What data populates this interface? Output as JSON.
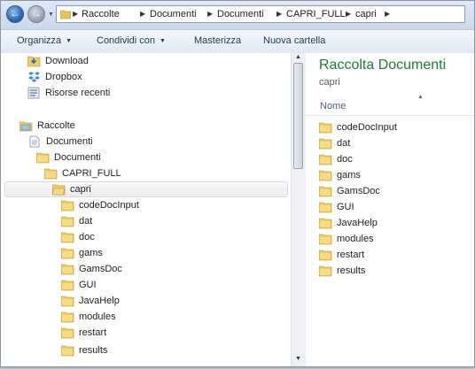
{
  "window": {
    "accent": "#2766b7"
  },
  "address_bar": {
    "back_icon": "back-arrow-icon",
    "forward_icon": "forward-arrow-icon",
    "breadcrumb": [
      "Raccolte",
      "Documenti",
      "Documenti",
      "CAPRI_FULL",
      "capri"
    ]
  },
  "toolbar": {
    "organize": "Organizza",
    "share": "Condividi con",
    "burn": "Masterizza",
    "new_folder": "Nuova cartella"
  },
  "nav": {
    "favorites": [
      {
        "label": "Download",
        "icon": "download-folder-icon"
      },
      {
        "label": "Dropbox",
        "icon": "dropbox-icon"
      },
      {
        "label": "Risorse recenti",
        "icon": "recent-places-icon"
      }
    ],
    "libraries_label": "Raccolte",
    "documents_label": "Documenti",
    "my_documents_label": "Documenti",
    "capri_full_label": "CAPRI_FULL",
    "capri_label": "capri",
    "subfolders": [
      "codeDocInput",
      "dat",
      "doc",
      "gams",
      "GamsDoc",
      "GUI",
      "JavaHelp",
      "modules",
      "restart",
      "results"
    ]
  },
  "content": {
    "title": "Raccolta Documenti",
    "subtitle": "capri",
    "column_name": "Nome",
    "files": [
      "codeDocInput",
      "dat",
      "doc",
      "gams",
      "GamsDoc",
      "GUI",
      "JavaHelp",
      "modules",
      "restart",
      "results"
    ],
    "title_color": "#1e7a3a"
  }
}
